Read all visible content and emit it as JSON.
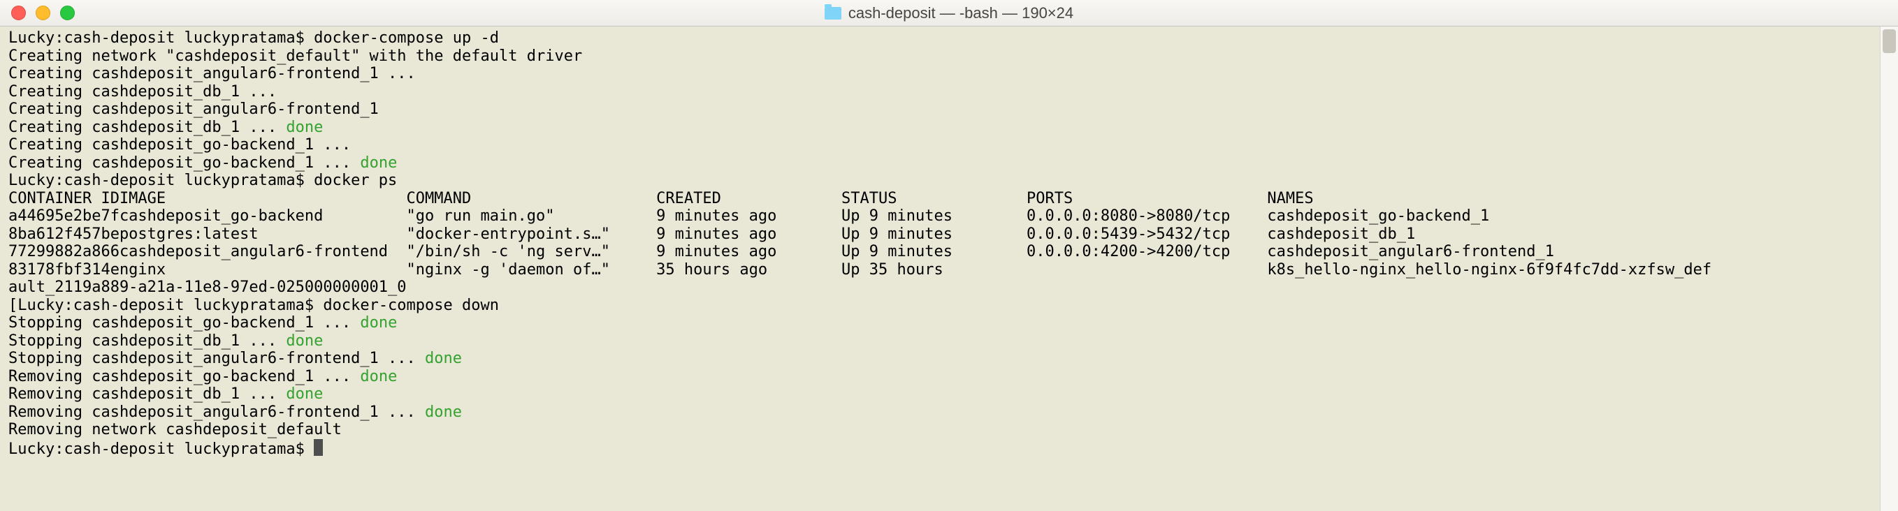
{
  "window": {
    "title": "cash-deposit — -bash — 190×24"
  },
  "prompt_base": "Lucky:cash-deposit luckypratama$ ",
  "cmd_up": "docker-compose up -d",
  "up_lines": [
    "Creating network \"cashdeposit_default\" with the default driver",
    "Creating cashdeposit_angular6-frontend_1 ...",
    "Creating cashdeposit_db_1 ..."
  ],
  "creating_af1": "Creating cashdeposit_angular6-frontend_1",
  "creating_db_done_pre": "Creating cashdeposit_db_1 ... ",
  "creating_go1": "Creating cashdeposit_go-backend_1 ...",
  "creating_go_done_pre": "Creating cashdeposit_go-backend_1 ... ",
  "done": "done",
  "cmd_ps": "docker ps",
  "ps": {
    "headers": [
      "CONTAINER ID",
      "IMAGE",
      "COMMAND",
      "CREATED",
      "STATUS",
      "PORTS",
      "NAMES"
    ],
    "rows": [
      {
        "id": "a44695e2be7f",
        "image": "cashdeposit_go-backend",
        "command": "\"go run main.go\"",
        "created": "9 minutes ago",
        "status": "Up 9 minutes",
        "ports": "0.0.0.0:8080->8080/tcp",
        "names": "cashdeposit_go-backend_1"
      },
      {
        "id": "8ba612f457be",
        "image": "postgres:latest",
        "command": "\"docker-entrypoint.s…\"",
        "created": "9 minutes ago",
        "status": "Up 9 minutes",
        "ports": "0.0.0.0:5439->5432/tcp",
        "names": "cashdeposit_db_1"
      },
      {
        "id": "77299882a866",
        "image": "cashdeposit_angular6-frontend",
        "command": "\"/bin/sh -c 'ng serv…\"",
        "created": "9 minutes ago",
        "status": "Up 9 minutes",
        "ports": "0.0.0.0:4200->4200/tcp",
        "names": "cashdeposit_angular6-frontend_1"
      },
      {
        "id": "83178fbf314e",
        "image": "nginx",
        "command": "\"nginx -g 'daemon of…\"",
        "created": "35 hours ago",
        "status": "Up 35 hours",
        "ports": "",
        "names": "k8s_hello-nginx_hello-nginx-6f9f4fc7dd-xzfsw_def"
      }
    ],
    "wrap": "ault_2119a889-a21a-11e8-97ed-025000000001_0"
  },
  "bracket_open": "[",
  "bracket_close": "]",
  "cmd_down": "docker-compose down",
  "stopping_go_pre": "Stopping cashdeposit_go-backend_1 ... ",
  "stopping_db_pre": "Stopping cashdeposit_db_1 ... ",
  "stopping_af_pre": "Stopping cashdeposit_angular6-frontend_1 ... ",
  "removing_go_pre": "Removing cashdeposit_go-backend_1 ... ",
  "removing_db_pre": "Removing cashdeposit_db_1 ... ",
  "removing_af_pre": "Removing cashdeposit_angular6-frontend_1 ... ",
  "removing_network": "Removing network cashdeposit_default"
}
